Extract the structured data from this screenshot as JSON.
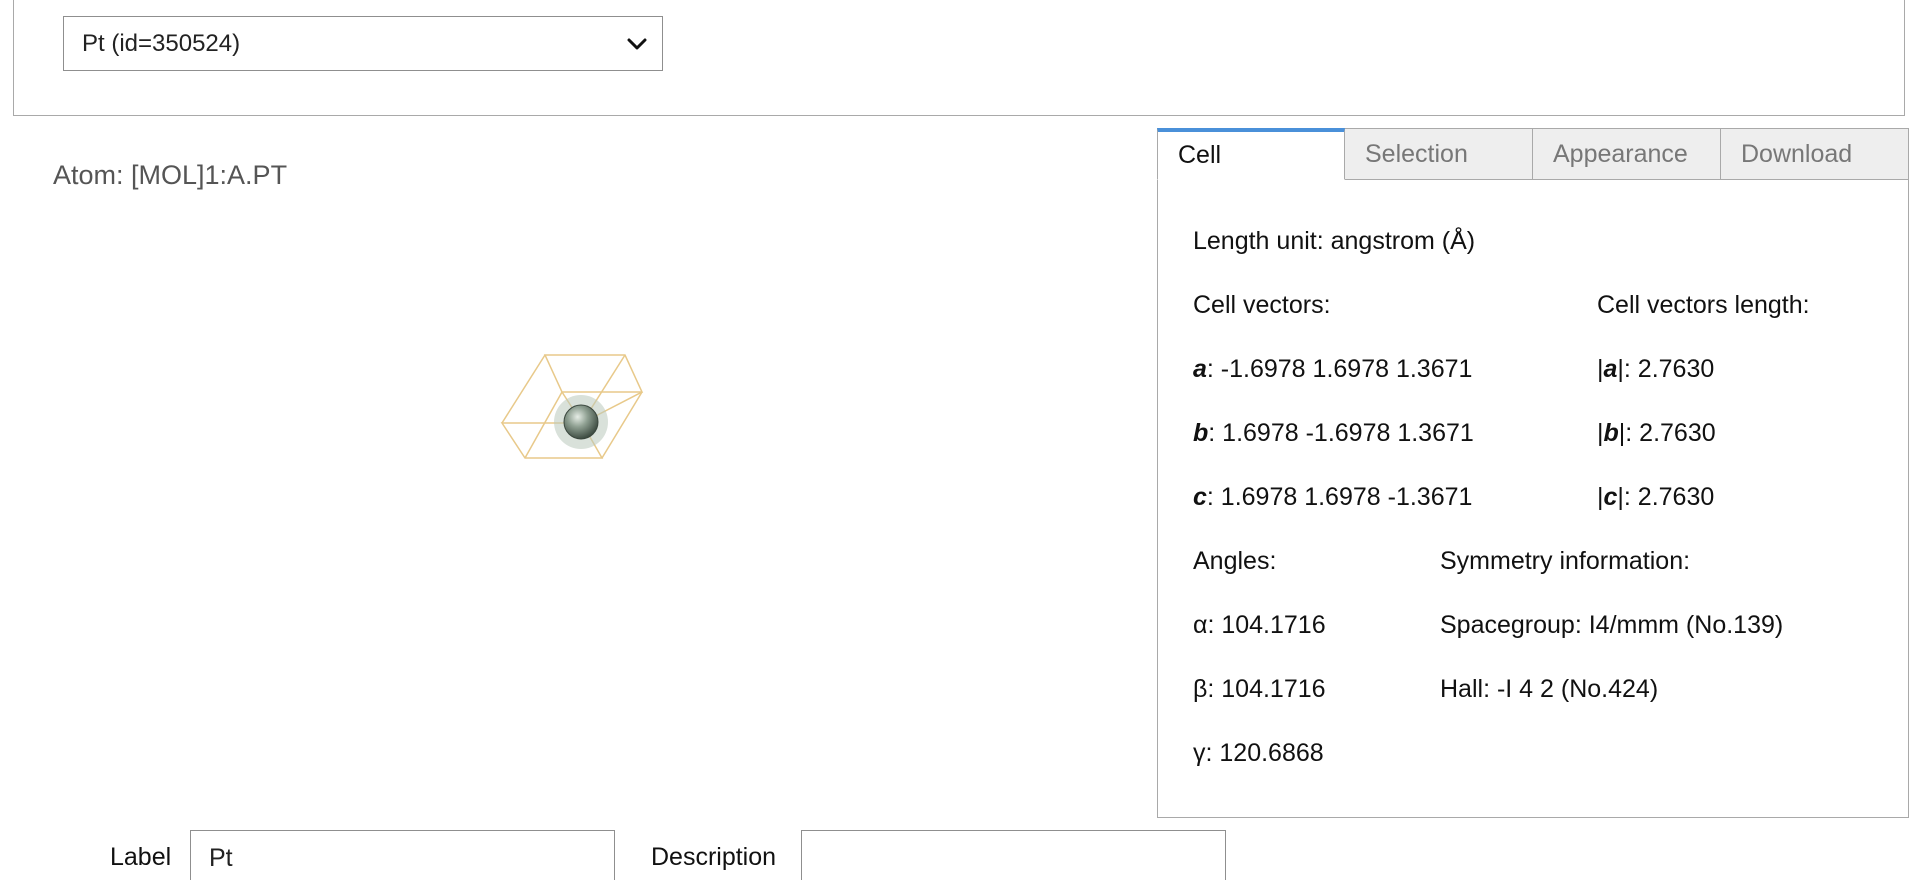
{
  "structure_select": {
    "value": "Pt (id=350524)"
  },
  "atom_label": "Atom: [MOL]1:A.PT",
  "tabs": [
    {
      "label": "Cell"
    },
    {
      "label": "Selection"
    },
    {
      "label": "Appearance"
    },
    {
      "label": "Download"
    }
  ],
  "cell": {
    "length_unit": "Length unit: angstrom (Å)",
    "vectors_heading": "Cell vectors:",
    "lengths_heading": "Cell vectors length:",
    "vectors": [
      {
        "name": "a",
        "values": ": -1.6978 1.6978 1.3671",
        "length": "2.7630"
      },
      {
        "name": "b",
        "values": ": 1.6978 -1.6978 1.3671",
        "length": "2.7630"
      },
      {
        "name": "c",
        "values": ": 1.6978 1.6978 -1.3671",
        "length": "2.7630"
      }
    ],
    "angles_heading": "Angles:",
    "symmetry_heading": "Symmetry information:",
    "angles": [
      "α: 104.1716",
      "β: 104.1716",
      "γ: 120.6868"
    ],
    "spacegroup": "Spacegroup: I4/mmm (No.139)",
    "hall": "Hall: -I 4 2 (No.424)"
  },
  "form": {
    "label_caption": "Label",
    "label_value": "Pt",
    "description_caption": "Description",
    "description_value": ""
  },
  "colors": {
    "accent": "#4a90d9",
    "cell_edges": "#e8c98a",
    "atom": "#7d8f80"
  }
}
